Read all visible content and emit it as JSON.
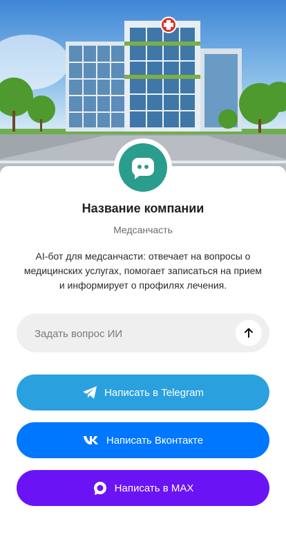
{
  "company": {
    "name": "Название компании",
    "category": "Медсанчасть",
    "description": "AI-бот для медсанчасти: отвечает на вопросы о медицинских услугах, помогает записаться на прием и информирует о профилях лечения."
  },
  "ask": {
    "placeholder": "Задать вопрос ИИ",
    "value": ""
  },
  "buttons": {
    "telegram": "Написать в Telegram",
    "vk": "Написать Вконтакте",
    "max": "Написать в MAX"
  },
  "colors": {
    "avatar_bg": "#2a9d8f",
    "telegram": "#2aa1de",
    "vk": "#0077ff",
    "max": "#6a14f5",
    "input_bg": "#efefef"
  },
  "icons": {
    "avatar": "chat-bubble-icon",
    "send": "arrow-up-icon",
    "telegram": "telegram-icon",
    "vk": "vk-icon",
    "max": "max-icon"
  }
}
